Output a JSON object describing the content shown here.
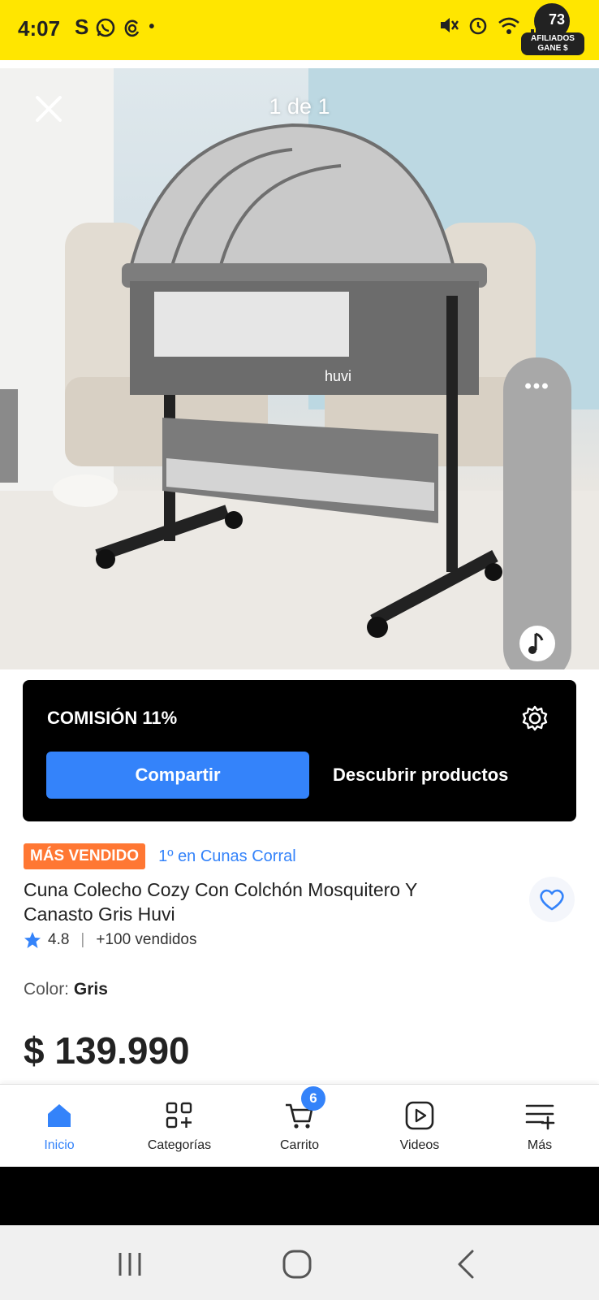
{
  "status_bar": {
    "time": "4:07",
    "left_icons": [
      "S",
      "whatsapp-icon",
      "threads-icon",
      "•"
    ],
    "right_icons": [
      "mute-icon",
      "alarm-icon",
      "wifi-icon",
      "signal-icon"
    ],
    "afiliados": {
      "count": "73",
      "label_line1": "AFILIADOS",
      "label_line2": "GANE $"
    }
  },
  "product_image": {
    "counter": "1 de 1",
    "brand_on_product": "huvi"
  },
  "commission": {
    "title": "COMISIÓN 11%",
    "share_label": "Compartir",
    "discover_label": "Descubrir productos"
  },
  "product": {
    "badge": "MÁS VENDIDO",
    "rank": "1º en Cunas Corral",
    "title": "Cuna Colecho Cozy Con Colchón Mosquitero Y Canasto Gris Huvi",
    "rating": "4.8",
    "sold": "+100 vendidos",
    "color_label": "Color: ",
    "color_value": "Gris",
    "price": "$ 139.990"
  },
  "bottom_nav": {
    "items": [
      {
        "label": "Inicio",
        "icon": "home-icon",
        "active": true
      },
      {
        "label": "Categorías",
        "icon": "categories-icon"
      },
      {
        "label": "Carrito",
        "icon": "cart-icon",
        "badge": "6"
      },
      {
        "label": "Videos",
        "icon": "video-icon"
      },
      {
        "label": "Más",
        "icon": "more-menu-icon"
      }
    ]
  },
  "colors": {
    "status_bar": "#ffe600",
    "primary_blue": "#3483fa",
    "best_seller_orange": "#ff7733",
    "card_black": "#000000"
  }
}
